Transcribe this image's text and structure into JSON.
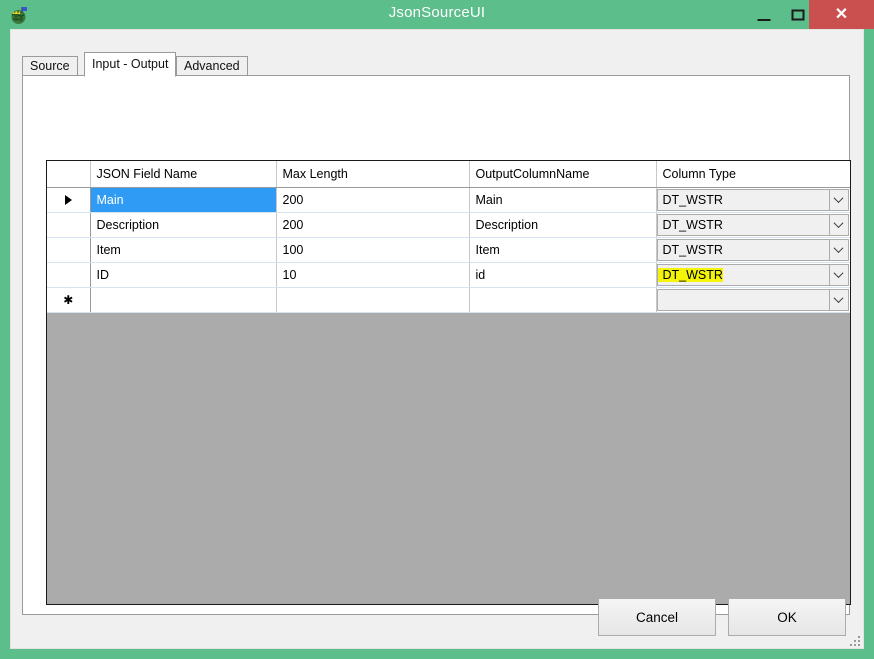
{
  "window": {
    "title": "JsonSourceUI",
    "icon": "globe-crown-icon",
    "titlebar_color": "#5BBE8B",
    "close_color": "#C9504F",
    "minimize_label": "",
    "maximize_label": "",
    "close_label": "✕"
  },
  "tabs": [
    {
      "label": "Source",
      "selected": false
    },
    {
      "label": "Input - Output",
      "selected": true
    },
    {
      "label": "Advanced",
      "selected": false
    }
  ],
  "grid": {
    "columns": [
      "JSON Field Name",
      "Max Length",
      "OutputColumnName",
      "Column Type"
    ],
    "selection_color": "#2F9BF5",
    "highlight_color": "#F4F40A",
    "background_color": "#ABABAB",
    "rows": [
      {
        "marker": "▶",
        "field_name": "Main",
        "max_length": "200",
        "output_column_name": "Main",
        "column_type": "DT_WSTR",
        "selected": true,
        "type_highlighted": false
      },
      {
        "marker": "",
        "field_name": "Description",
        "max_length": "200",
        "output_column_name": "Description",
        "column_type": "DT_WSTR",
        "selected": false,
        "type_highlighted": false
      },
      {
        "marker": "",
        "field_name": "Item",
        "max_length": "100",
        "output_column_name": "Item",
        "column_type": "DT_WSTR",
        "selected": false,
        "type_highlighted": false
      },
      {
        "marker": "",
        "field_name": "ID",
        "max_length": "10",
        "output_column_name": "id",
        "column_type": "DT_WSTR",
        "selected": false,
        "type_highlighted": true
      },
      {
        "marker": "✱",
        "field_name": "",
        "max_length": "",
        "output_column_name": "",
        "column_type": "",
        "selected": false,
        "type_highlighted": false,
        "is_new_row": true
      }
    ]
  },
  "footer": {
    "cancel_label": "Cancel",
    "ok_label": "OK"
  }
}
